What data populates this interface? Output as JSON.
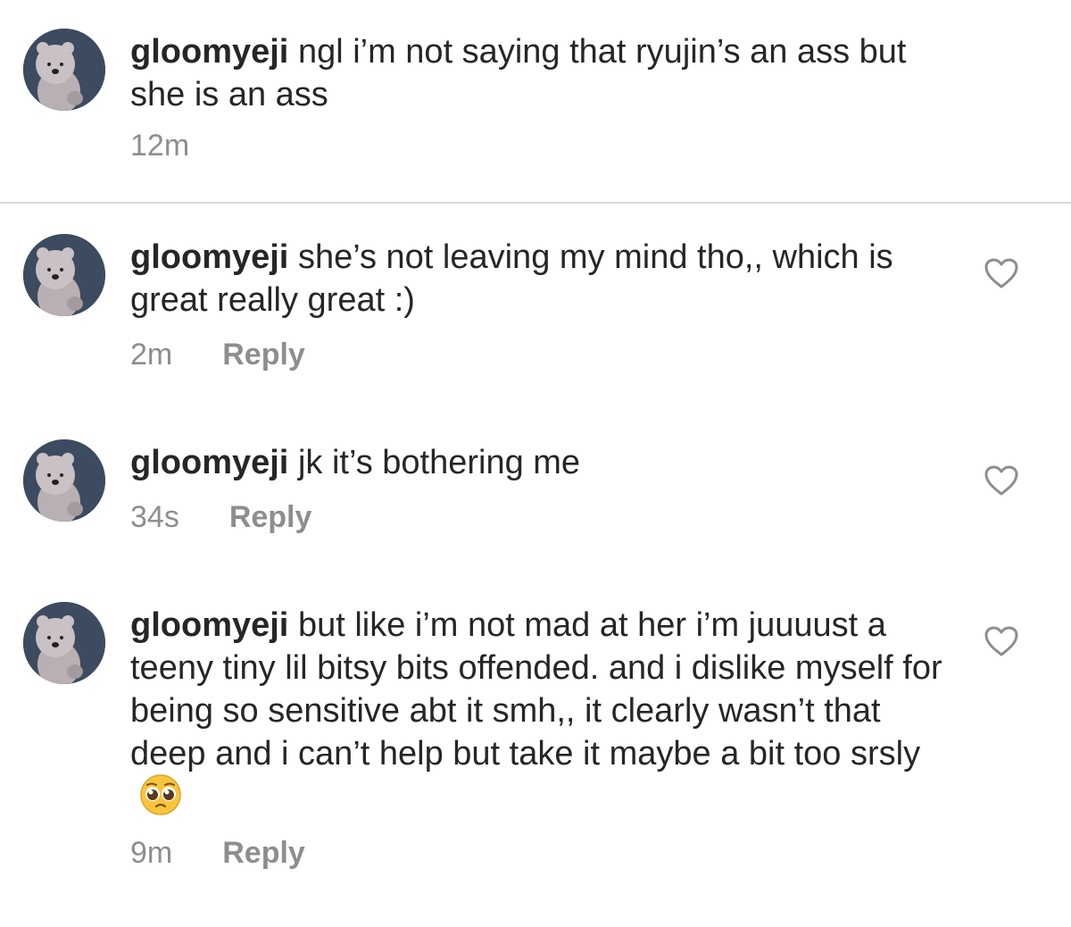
{
  "comments": [
    {
      "username": "gloomyeji",
      "text": "ngl i’m not saying that ryujin’s an ass but she is an ass",
      "time": "12m",
      "reply": ""
    },
    {
      "username": "gloomyeji",
      "text": "she’s not leaving my mind tho,, which is great really great :)",
      "time": "2m",
      "reply": "Reply"
    },
    {
      "username": "gloomyeji",
      "text": "jk it’s bothering me",
      "time": "34s",
      "reply": "Reply"
    },
    {
      "username": "gloomyeji",
      "text": "but like i’m not mad at her i’m juuuust a teeny tiny lil bitsy bits offended. and i dislike myself for being so sensitive abt it smh,, it clearly wasn’t that deep and i can’t help but take it maybe a bit too srsly",
      "time": "9m",
      "reply": "Reply"
    }
  ],
  "icons": {
    "avatar": "bear-avatar",
    "like": "heart-icon",
    "emoji": "pleading-face-emoji"
  },
  "colors": {
    "text": "#262626",
    "secondary": "#8e8e8e",
    "divider": "#dbdbdb"
  }
}
